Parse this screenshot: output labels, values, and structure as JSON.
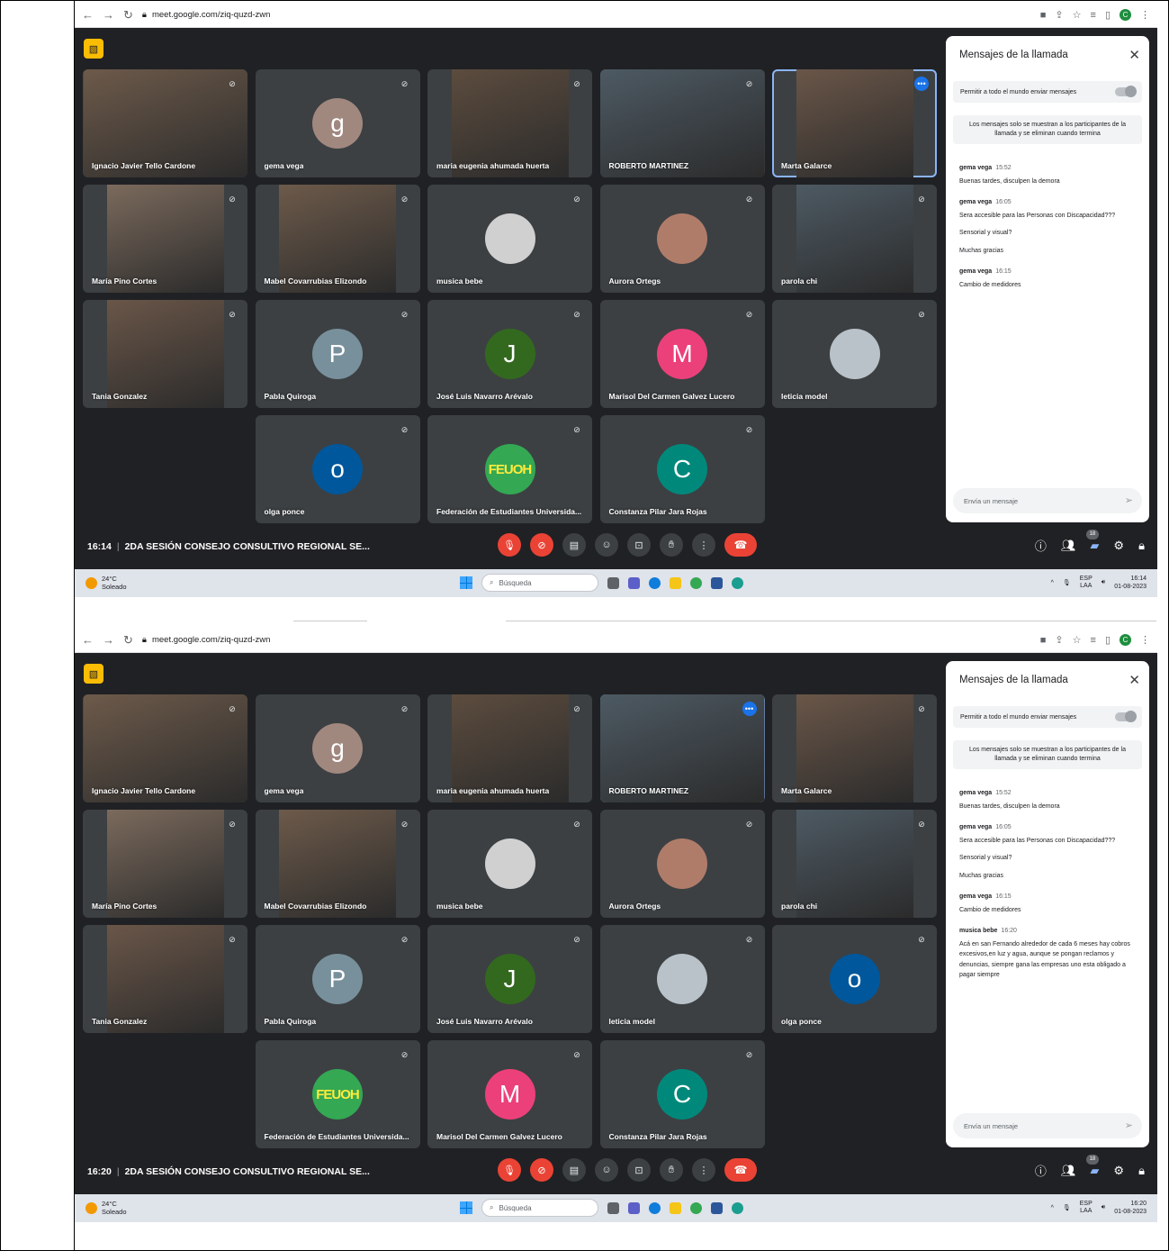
{
  "browser": {
    "url": "meet.google.com/ziq-quzd-zwn",
    "profile_initial": "C"
  },
  "panel": {
    "title": "Mensajes de la llamada",
    "toggle_label": "Permitir a todo el mundo enviar mensajes",
    "note": "Los mensajes solo se muestran a los participantes de la llamada y se eliminan cuando termina",
    "input_placeholder": "Envía un mensaje"
  },
  "meeting": {
    "title": "2DA SESIÓN CONSEJO CONSULTIVO REGIONAL SE...",
    "participant_count": "18"
  },
  "taskbar": {
    "temp": "24°C",
    "weather": "Soleado",
    "search": "Búsqueda",
    "lang": "ESP",
    "lang2": "LAA",
    "date": "01-08-2023"
  },
  "shot1": {
    "clock": "16:14",
    "tray_time": "16:14",
    "tiles": [
      {
        "name": "Ignacio Javier Tello Cardone"
      },
      {
        "name": "gema vega",
        "letter": "g"
      },
      {
        "name": "maria eugenia ahumada huerta"
      },
      {
        "name": "ROBERTO MARTINEZ"
      },
      {
        "name": "Marta Galarce"
      },
      {
        "name": "María Pino Cortes"
      },
      {
        "name": "Mabel Covarrubias Elizondo"
      },
      {
        "name": "musica bebe"
      },
      {
        "name": "Aurora Ortegs"
      },
      {
        "name": "parola chi"
      },
      {
        "name": "Tania Gonzalez"
      },
      {
        "name": "Pabla Quiroga",
        "letter": "P"
      },
      {
        "name": "José Luis Navarro Arévalo",
        "letter": "J"
      },
      {
        "name": "Marisol Del Carmen Galvez Lucero",
        "letter": "M"
      },
      {
        "name": "leticia model"
      },
      {
        "name": "olga ponce",
        "letter": "o"
      },
      {
        "name": "Federación de Estudiantes Universida...",
        "letter": "FEUOH"
      },
      {
        "name": "Constanza Pilar Jara Rojas",
        "letter": "C"
      }
    ],
    "messages": [
      {
        "who": "gema vega",
        "time": "15:52",
        "lines": [
          "Buenas tardes, disculpen la demora"
        ]
      },
      {
        "who": "gema vega",
        "time": "16:05",
        "lines": [
          "Sera accesible para las Personas con Discapacidad???",
          "Sensorial y visual?",
          "Muchas gracias"
        ]
      },
      {
        "who": "gema vega",
        "time": "16:15",
        "lines": [
          "Cambio de medidores"
        ]
      }
    ]
  },
  "shot2": {
    "clock": "16:20",
    "tray_time": "16:20",
    "tiles": [
      {
        "name": "Ignacio Javier Tello Cardone"
      },
      {
        "name": "gema vega",
        "letter": "g"
      },
      {
        "name": "maria eugenia ahumada huerta"
      },
      {
        "name": "ROBERTO MARTINEZ"
      },
      {
        "name": "Marta Galarce"
      },
      {
        "name": "María Pino Cortes"
      },
      {
        "name": "Mabel Covarrubias Elizondo"
      },
      {
        "name": "musica bebe"
      },
      {
        "name": "Aurora Ortegs"
      },
      {
        "name": "parola chi"
      },
      {
        "name": "Tania Gonzalez"
      },
      {
        "name": "Pabla Quiroga",
        "letter": "P"
      },
      {
        "name": "José Luis Navarro Arévalo",
        "letter": "J"
      },
      {
        "name": "leticia model"
      },
      {
        "name": "olga ponce",
        "letter": "o"
      },
      {
        "name": "Federación de Estudiantes Universida...",
        "letter": "FEUOH"
      },
      {
        "name": "Marisol Del Carmen Galvez Lucero",
        "letter": "M"
      },
      {
        "name": "Constanza Pilar Jara Rojas",
        "letter": "C"
      }
    ],
    "messages": [
      {
        "who": "gema vega",
        "time": "15:52",
        "lines": [
          "Buenas tardes, disculpen la demora"
        ]
      },
      {
        "who": "gema vega",
        "time": "16:05",
        "lines": [
          "Sera accesible para las Personas con Discapacidad???",
          "Sensorial y visual?",
          "Muchas gracias"
        ]
      },
      {
        "who": "gema vega",
        "time": "16:15",
        "lines": [
          "Cambio de medidores"
        ]
      },
      {
        "who": "musica bebe",
        "time": "16:20",
        "lines": [
          "Acá en san Fernando alrededor de cada 6 meses hay cobros excesivos,en luz y agua, aunque se pongan reclamos y denuncias, siempre gana las empresas uno esta obligado a pagar siempre"
        ]
      }
    ]
  },
  "colors": {
    "meet_bg": "#202124",
    "tile_bg": "#3c4043",
    "speaker_outline": "#8ab4f8",
    "end_call": "#ea4335",
    "avatar_g": "#a1887f",
    "avatar_p": "#78909c",
    "avatar_j": "#33691e",
    "avatar_m": "#ec407a",
    "avatar_o": "#01579b",
    "avatar_c": "#00897b"
  }
}
